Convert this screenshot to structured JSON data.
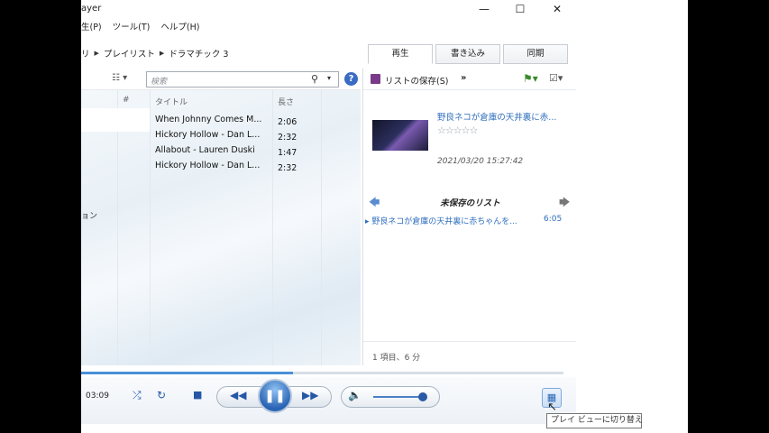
{
  "window": {
    "title": "ayer",
    "controls": {
      "minimize": "—",
      "maximize": "☐",
      "close": "✕"
    }
  },
  "menu": [
    "生(P)",
    "ツール(T)",
    "ヘルプ(H)"
  ],
  "breadcrumb": [
    "リ",
    "プレイリスト",
    "ドラマチック 3"
  ],
  "tabs": [
    {
      "label": "再生",
      "active": true
    },
    {
      "label": "書き込み",
      "active": false
    },
    {
      "label": "同期",
      "active": false
    }
  ],
  "search": {
    "placeholder": "検索"
  },
  "library": {
    "columns": {
      "number": "#",
      "title": "タイトル",
      "length": "長さ"
    },
    "sidebar_partial": "ョン",
    "rows": [
      {
        "title": "When Johnny Comes M...",
        "length": "2:06"
      },
      {
        "title": "Hickory Hollow - Dan L...",
        "length": "2:32"
      },
      {
        "title": "Allabout - Lauren Duski",
        "length": "1:47"
      },
      {
        "title": "Hickory Hollow - Dan L...",
        "length": "2:32"
      }
    ]
  },
  "playpane": {
    "save_list": "リストの保存(S)",
    "more": "»",
    "now_playing": {
      "title": "野良ネコが倉庫の天井裏に赤...",
      "rating_stars": "☆☆☆☆☆",
      "date": "2021/03/20 15:27:42"
    },
    "list_name": "未保存のリスト",
    "items": [
      {
        "title": "野良ネコが倉庫の天井裏に赤ちゃんを...",
        "duration": "6:05"
      }
    ],
    "footer": "1 項目、6 分"
  },
  "player": {
    "time": "03:09",
    "seek_progress": 0.44,
    "volume": 0.95
  },
  "tooltip": "プレイ ビューに切り替え",
  "icons": {
    "view_options": "view-options-icon",
    "search": "search-icon",
    "help": "help-icon",
    "save": "save-icon",
    "shuffle": "shuffle-icon",
    "repeat": "repeat-icon",
    "stop": "stop-icon",
    "previous": "previous-icon",
    "pause": "pause-icon",
    "next": "next-icon",
    "volume": "speaker-icon",
    "switch_view": "switch-view-icon"
  },
  "colors": {
    "accent": "#2f6ebd",
    "play_button": "#2a64b4"
  }
}
